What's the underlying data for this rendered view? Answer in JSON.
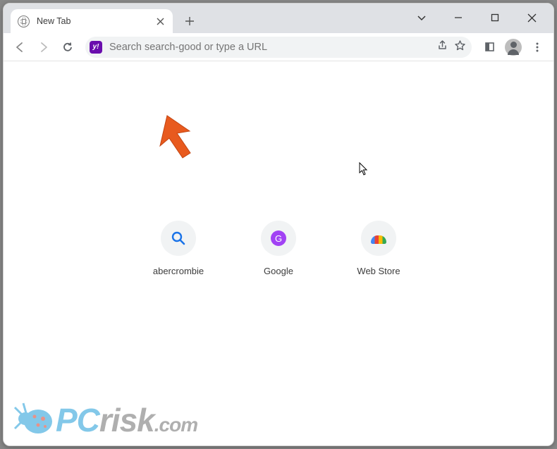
{
  "tab": {
    "title": "New Tab"
  },
  "omnibox": {
    "search_engine_badge": "y!",
    "placeholder": "Search search-good or type a URL"
  },
  "shortcuts": [
    {
      "label": "abercrombie",
      "kind": "search"
    },
    {
      "label": "Google",
      "kind": "google",
      "letter": "G"
    },
    {
      "label": "Web Store",
      "kind": "webstore"
    }
  ],
  "watermark": {
    "brand_a": "PC",
    "brand_b": "risk",
    "suffix": ".com"
  }
}
